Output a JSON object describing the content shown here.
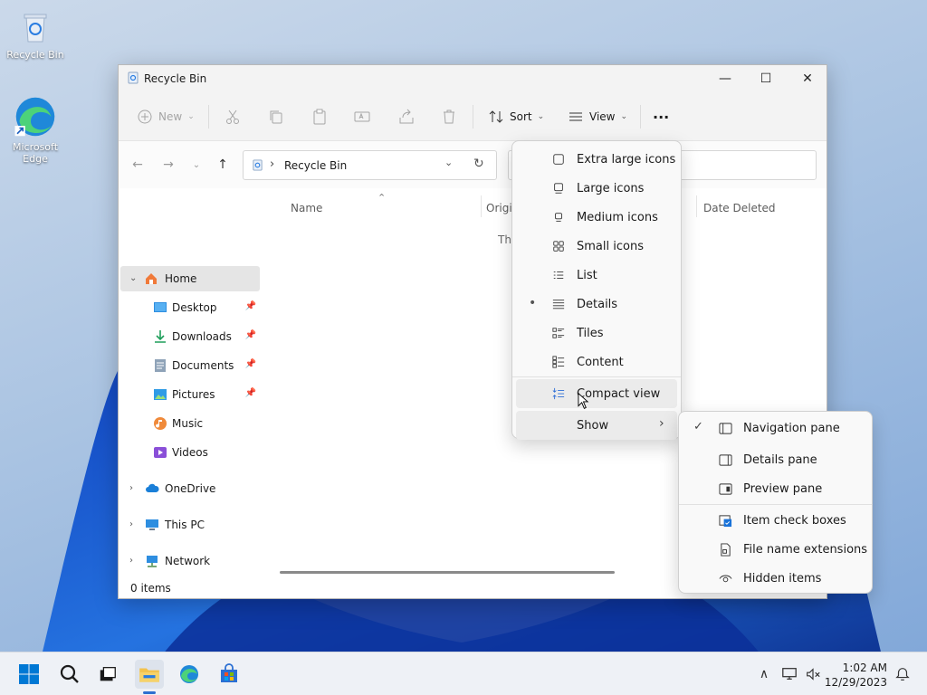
{
  "desktop": {
    "icons": [
      {
        "label": "Recycle Bin"
      },
      {
        "label": "Microsoft Edge"
      }
    ]
  },
  "window": {
    "title": "Recycle Bin",
    "buttons": {
      "minimize": "—",
      "maximize": "☐",
      "close": "✕"
    }
  },
  "toolbar": {
    "new_label": "New",
    "sort_label": "Sort",
    "view_label": "View",
    "more_label": "···"
  },
  "address": {
    "separator": "›",
    "path": "Recycle Bin"
  },
  "sidebar": {
    "items": [
      {
        "label": "Home"
      },
      {
        "label": "Desktop"
      },
      {
        "label": "Downloads"
      },
      {
        "label": "Documents"
      },
      {
        "label": "Pictures"
      },
      {
        "label": "Music"
      },
      {
        "label": "Videos"
      },
      {
        "label": "OneDrive"
      },
      {
        "label": "This PC"
      },
      {
        "label": "Network"
      }
    ]
  },
  "columns": {
    "name": "Name",
    "original": "Origi",
    "date_deleted": "Date Deleted"
  },
  "content": {
    "empty_text": "Thi"
  },
  "status": {
    "items": "0 items"
  },
  "view_menu": {
    "items": [
      {
        "label": "Extra large icons"
      },
      {
        "label": "Large icons"
      },
      {
        "label": "Medium icons"
      },
      {
        "label": "Small icons"
      },
      {
        "label": "List"
      },
      {
        "label": "Details",
        "selected": true
      },
      {
        "label": "Tiles"
      },
      {
        "label": "Content"
      },
      {
        "label": "Compact view"
      },
      {
        "label": "Show"
      }
    ],
    "selected_bullet": "•",
    "submenu_arrow": "›"
  },
  "show_menu": {
    "items": [
      {
        "label": "Navigation pane",
        "checked": true
      },
      {
        "label": "Details pane"
      },
      {
        "label": "Preview pane"
      },
      {
        "label": "Item check boxes"
      },
      {
        "label": "File name extensions"
      },
      {
        "label": "Hidden items"
      }
    ],
    "check_mark": "✓"
  },
  "taskbar": {
    "time": "1:02 AM",
    "date": "12/29/2023",
    "chevron": "∧"
  },
  "colors": {
    "accent": "#0067c0",
    "folder": "#f3c24b",
    "start": "#0078d4"
  }
}
